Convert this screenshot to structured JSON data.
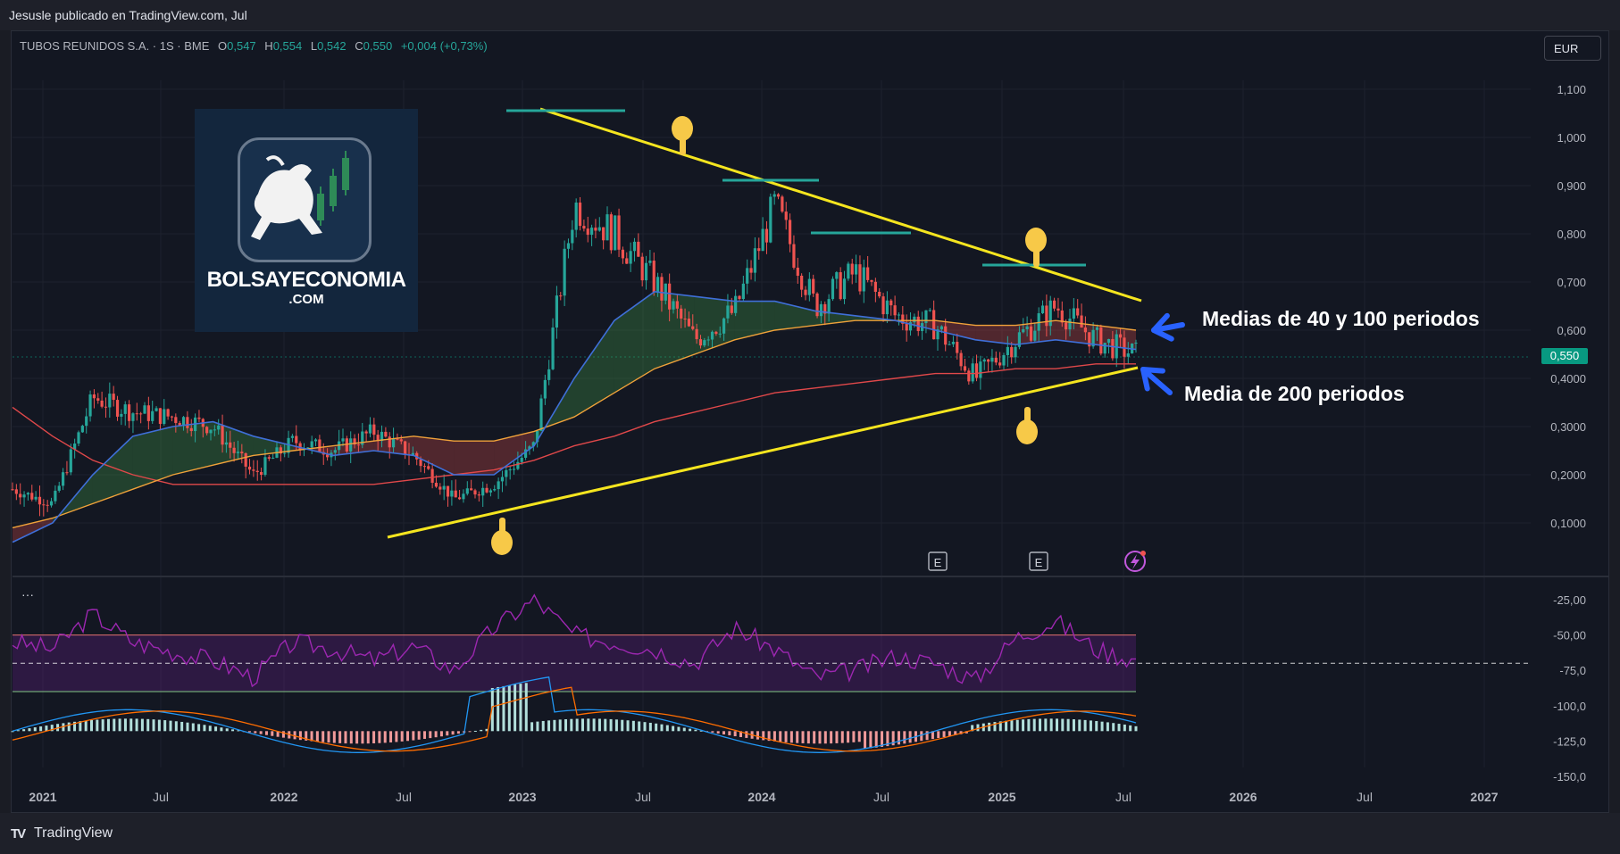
{
  "header": {
    "publisher_text": "Jesusle publicado en TradingView.com, Jul"
  },
  "legend": {
    "symbol": "TUBOS REUNIDOS S.A. · 1S · BME",
    "open_label": "O",
    "open": "0,547",
    "high_label": "H",
    "high": "0,554",
    "low_label": "L",
    "low": "0,542",
    "close_label": "C",
    "close": "0,550",
    "change": "+0,004 (+0,73%)"
  },
  "currency_button": "EUR",
  "last_price_tag": "0,550",
  "indicator_menu": "···",
  "watermark": {
    "title": "BOLSAYECONOMIA",
    "subtitle": ".COM"
  },
  "annotations": {
    "moving_averages": "Medias de 40 y 100 periodos",
    "ma200": "Media de 200 periodos"
  },
  "event_markers": [
    {
      "label": "E"
    },
    {
      "label": "E"
    }
  ],
  "footer": {
    "brand": "TradingView",
    "logo": "TV"
  },
  "colors": {
    "background": "#131722",
    "up": "#26a69a",
    "down": "#ef5350",
    "ma40": "#3f6fd8",
    "ma100": "#f0a23a",
    "ma200": "#e0484a",
    "trendline": "#f5e51f",
    "rsi": "#9c27b0",
    "macd": "#2196f3",
    "signal": "#ff6d00",
    "arrows": "#2962ff",
    "hand": "#f7c948"
  },
  "chart_data": [
    {
      "type": "line",
      "subtype": "candlestick-weekly",
      "title": "",
      "x_axis": {
        "ticks": [
          "2021",
          "Jul",
          "2022",
          "Jul",
          "2023",
          "Jul",
          "2024",
          "Jul",
          "2025",
          "Jul",
          "2026",
          "Jul",
          "2027"
        ]
      },
      "y_axis": {
        "ticks": [
          "1,100",
          "1,000",
          "0,900",
          "0,800",
          "0,700",
          "0,600",
          "0,4000",
          "0,3000",
          "0,2000",
          "0,1000"
        ],
        "range": [
          0.1,
          1.1
        ]
      },
      "series": [
        {
          "name": "",
          "x": [
            "2021-01",
            "2021-03",
            "2021-05",
            "2021-07",
            "2021-09",
            "2021-11",
            "2022-01",
            "2022-03",
            "2022-05",
            "2022-07",
            "2022-09",
            "2022-11",
            "2023-01",
            "2023-03",
            "2023-04",
            "2023-06",
            "2023-08",
            "2023-10",
            "2023-12",
            "2024-01",
            "2024-03",
            "2024-05",
            "2024-07",
            "2024-09",
            "2024-11",
            "2025-01",
            "2025-03",
            "2025-05",
            "2025-07"
          ],
          "y": [
            0.27,
            0.24,
            0.46,
            0.43,
            0.42,
            0.4,
            0.3,
            0.37,
            0.35,
            0.39,
            0.34,
            0.25,
            0.28,
            0.36,
            0.86,
            0.8,
            0.7,
            0.58,
            0.64,
            0.86,
            0.65,
            0.72,
            0.63,
            0.61,
            0.5,
            0.58,
            0.65,
            0.58,
            0.55
          ]
        }
      ],
      "moving_averages": {
        "ma40": [
          0.16,
          0.2,
          0.3,
          0.38,
          0.4,
          0.41,
          0.38,
          0.36,
          0.34,
          0.35,
          0.34,
          0.3,
          0.3,
          0.36,
          0.5,
          0.62,
          0.68,
          0.67,
          0.66,
          0.66,
          0.64,
          0.63,
          0.62,
          0.6,
          0.58,
          0.57,
          0.58,
          0.57,
          0.56
        ],
        "ma100": [
          0.19,
          0.21,
          0.24,
          0.27,
          0.3,
          0.32,
          0.34,
          0.35,
          0.36,
          0.37,
          0.38,
          0.37,
          0.37,
          0.39,
          0.42,
          0.47,
          0.52,
          0.55,
          0.58,
          0.6,
          0.61,
          0.62,
          0.62,
          0.62,
          0.61,
          0.61,
          0.62,
          0.61,
          0.6
        ],
        "ma200": [
          0.44,
          0.38,
          0.33,
          0.3,
          0.28,
          0.28,
          0.28,
          0.28,
          0.28,
          0.28,
          0.29,
          0.3,
          0.31,
          0.33,
          0.36,
          0.38,
          0.41,
          0.43,
          0.45,
          0.47,
          0.48,
          0.49,
          0.5,
          0.51,
          0.51,
          0.52,
          0.52,
          0.53,
          0.53
        ]
      }
    },
    {
      "type": "line",
      "subtype": "rsi-macd",
      "y_axis": {
        "ticks": [
          "-25,00",
          "-50,00",
          "-75,0",
          "-100,0",
          "-125,0",
          "-150,0"
        ]
      },
      "series": [
        {
          "name": "",
          "values": [
            -55,
            -60,
            -35,
            -55,
            -62,
            -68,
            -80,
            -55,
            -60,
            -68,
            -58,
            -75,
            -45,
            -25,
            -50,
            -55,
            -60,
            -70,
            -45,
            -60,
            -80,
            -75,
            -65,
            -70,
            -82,
            -52,
            -40,
            -60,
            -68
          ]
        }
      ]
    }
  ]
}
